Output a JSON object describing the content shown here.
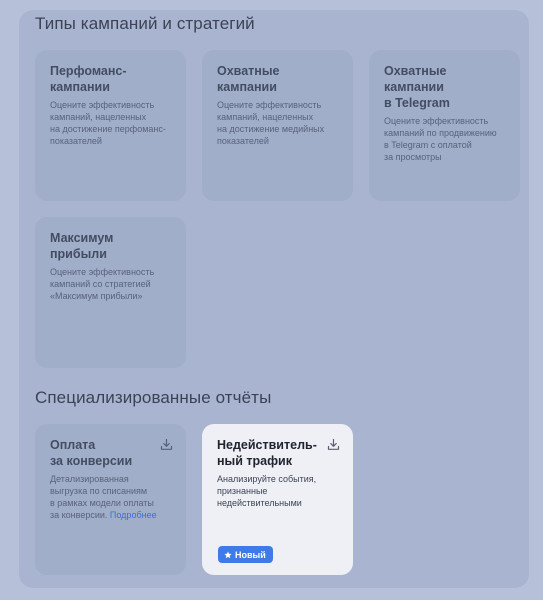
{
  "sections": {
    "campaigns_title": "Типы кампаний и стратегий",
    "special_title": "Специализированные отчёты"
  },
  "cards": {
    "performance": {
      "title": "Перфоманс-\nкампании",
      "desc": "Оцените эффективность\nкампаний, нацеленных\nна достижение перфоманс-\nпоказателей"
    },
    "reach": {
      "title": "Охватные кампании",
      "desc": "Оцените эффективность\nкампаний, нацеленных\nна достижение медийных\nпоказателей"
    },
    "telegram": {
      "title": "Охватные кампании\nв Telegram",
      "desc": "Оцените эффективность\nкампаний по продвижению\nв Telegram с оплатой\nза просмотры"
    },
    "max_profit": {
      "title": "Максимум прибыли",
      "desc": "Оцените эффективность\nкампаний со стратегией\n«Максимум прибыли»"
    },
    "conversion": {
      "title": "Оплата\nза конверсии",
      "desc": "Детализированная\nвыгрузка по списаниям\nв рамках модели оплаты\nза конверсии. ",
      "link": "Подробнее"
    },
    "invalid_traffic": {
      "title": "Недействитель-\nный трафик",
      "desc": "Анализируйте события,\nпризнанные\nнедействительными",
      "badge": "Новый"
    }
  },
  "icons": {
    "download": "download-icon",
    "star": "star-icon"
  },
  "colors": {
    "accent": "#3f7be6",
    "link": "#3b6fd8"
  }
}
